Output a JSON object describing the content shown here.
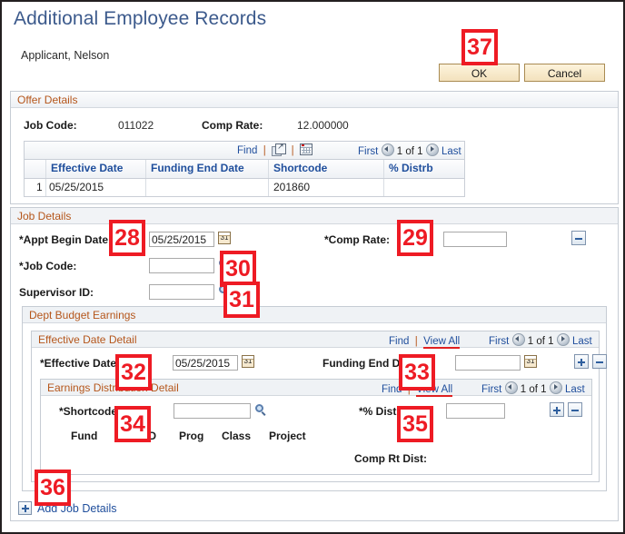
{
  "page": {
    "title": "Additional Employee Records",
    "applicant": "Applicant, Nelson"
  },
  "buttons": {
    "ok": "OK",
    "cancel": "Cancel"
  },
  "offer_details": {
    "section_title": "Offer Details",
    "job_code_label": "Job Code:",
    "job_code_value": "011022",
    "comp_rate_label": "Comp Rate:",
    "comp_rate_value": "12.000000",
    "nav": {
      "find": "Find",
      "first": "First",
      "page": "1 of 1",
      "last": "Last",
      "excel_icon": "download-to-excel-icon",
      "grid_icon": "grid-view-icon"
    },
    "columns": [
      "Effective Date",
      "Funding End Date",
      "Shortcode",
      "% Distrb"
    ],
    "rows": [
      {
        "num": "1",
        "effective_date": "05/25/2015",
        "funding_end_date": "",
        "shortcode": "201860",
        "pct_distrb": ""
      }
    ]
  },
  "job_details": {
    "section_title": "Job Details",
    "appt_begin_date_label": "*Appt Begin Date:",
    "appt_begin_date_value": "05/25/2015",
    "comp_rate_label": "*Comp Rate:",
    "comp_rate_value": "",
    "job_code_label": "*Job Code:",
    "job_code_value": "",
    "supervisor_id_label": "Supervisor ID:",
    "supervisor_id_value": "",
    "collapse_icon": "minus-row-icon"
  },
  "dept_budget_earnings": {
    "section_title": "Dept Budget Earnings",
    "effective_date_detail": {
      "section_title": "Effective Date Detail",
      "nav": {
        "find": "Find",
        "view_all": "View All",
        "first": "First",
        "page": "1 of 1",
        "last": "Last"
      },
      "effective_date_label": "*Effective Date:",
      "effective_date_value": "05/25/2015",
      "funding_end_date_label": "Funding End Date:",
      "funding_end_date_value": ""
    },
    "earnings_distribution_detail": {
      "section_title": "Earnings Distribution Detail",
      "nav": {
        "find": "Find",
        "view_all": "View All",
        "first": "First",
        "page": "1 of 1",
        "last": "Last"
      },
      "shortcode_label": "*Shortcode:",
      "shortcode_value": "",
      "pct_dist_label": "*% Dist:",
      "pct_dist_value": "",
      "chartfield_headers": [
        "Fund",
        "Dept ID",
        "Prog",
        "Class",
        "Project"
      ],
      "comp_rt_dist_label": "Comp Rt Dist:"
    }
  },
  "add_job_details": {
    "label": "Add Job Details",
    "icon": "plus-icon"
  },
  "callouts": [
    {
      "id": "28",
      "text": "28"
    },
    {
      "id": "29",
      "text": "29"
    },
    {
      "id": "30",
      "text": "30"
    },
    {
      "id": "31",
      "text": "31"
    },
    {
      "id": "32",
      "text": "32"
    },
    {
      "id": "33",
      "text": "33"
    },
    {
      "id": "34",
      "text": "34"
    },
    {
      "id": "35",
      "text": "35"
    },
    {
      "id": "36",
      "text": "36"
    },
    {
      "id": "37",
      "text": "37"
    }
  ],
  "colors": {
    "title_blue": "#3c5a8c",
    "section_orange": "#b5561b",
    "link_blue": "#1f4e9c",
    "callout_red": "#ee1b24",
    "button_tan": "#f3e2bd"
  }
}
